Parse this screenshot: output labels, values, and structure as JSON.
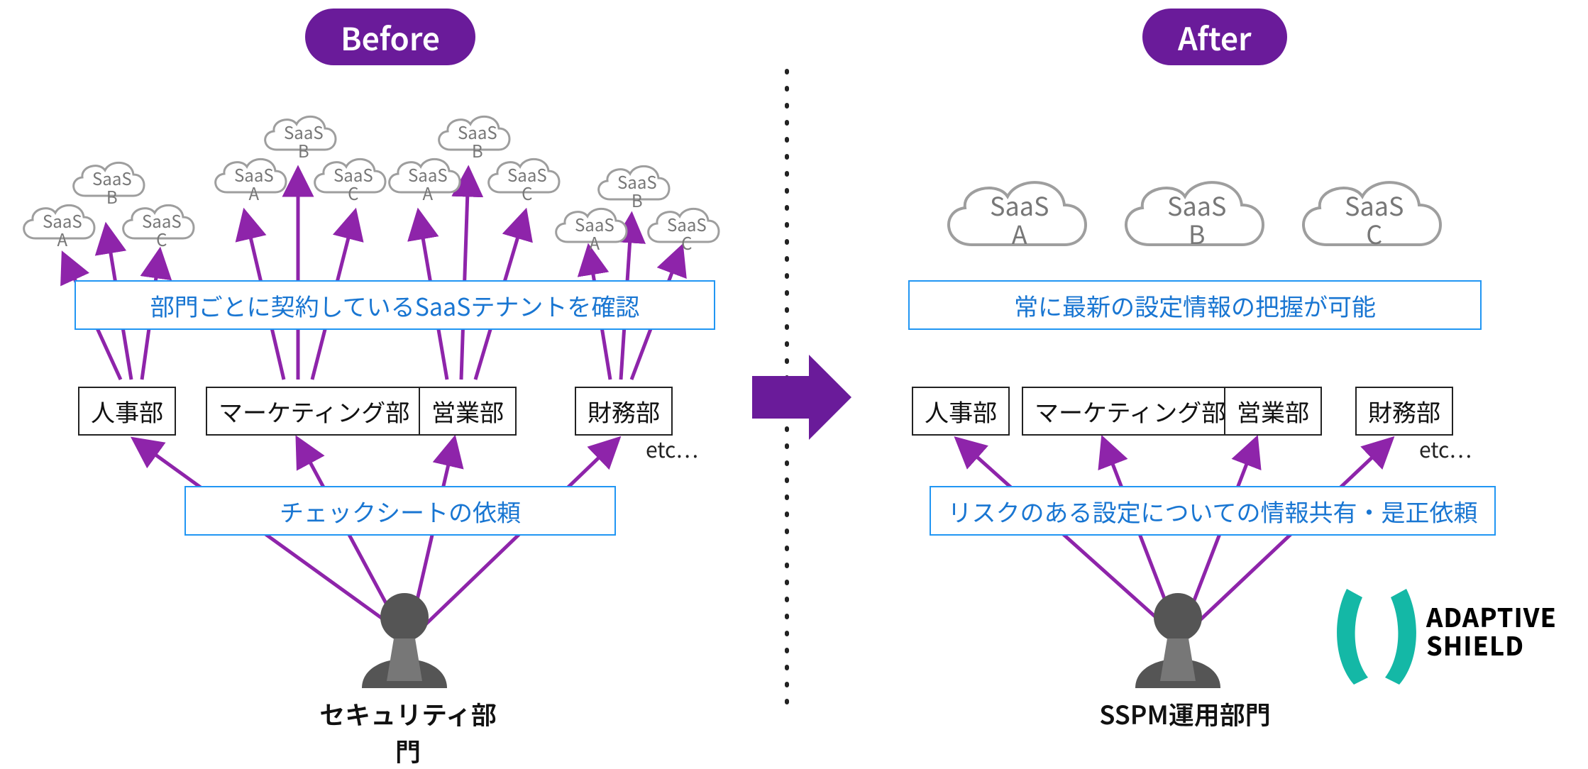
{
  "header": {
    "before": "Before",
    "after": "After"
  },
  "clouds": {
    "a": "SaaS\nA",
    "b": "SaaS\nB",
    "c": "SaaS\nC"
  },
  "before": {
    "note_top": "部門ごとに契約しているSaaSテナントを確認",
    "note_bottom": "チェックシートの依頼",
    "role": "セキュリティ部門"
  },
  "after": {
    "note_top": "常に最新の設定情報の把握が可能",
    "note_bottom": "リスクのある設定についての情報共有・是正依頼",
    "role": "SSPM運用部門"
  },
  "departments": [
    "人事部",
    "マーケティング部",
    "営業部",
    "財務部"
  ],
  "etc": "etc…",
  "logo": {
    "line1": "ADAPTIVE",
    "line2": "SHIELD"
  },
  "colors": {
    "purple": "#6a1b9a",
    "arrow": "#8e24aa",
    "cloudStroke": "#9e9e9e",
    "blue": "#1976d2",
    "teal": "#14b8a6"
  }
}
